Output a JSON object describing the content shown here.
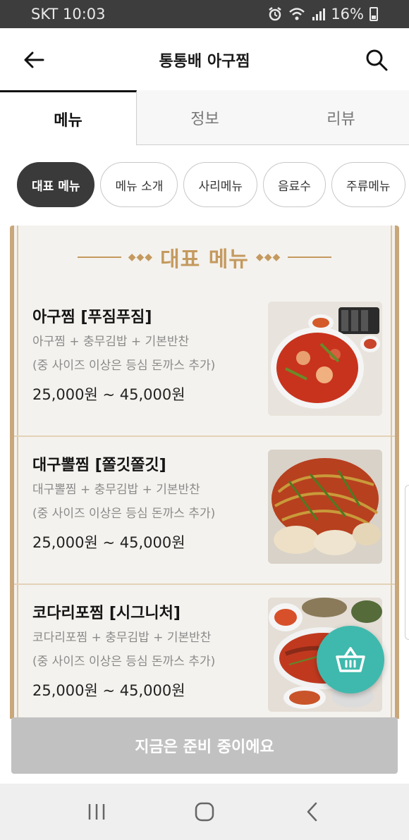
{
  "status_bar": {
    "carrier_time": "SKT 10:03",
    "battery": "16%"
  },
  "header": {
    "title": "통통배 아구찜",
    "back_icon": "arrow-left-icon",
    "search_icon": "search-icon"
  },
  "tabs": [
    {
      "label": "메뉴",
      "active": true
    },
    {
      "label": "정보",
      "active": false
    },
    {
      "label": "리뷰",
      "active": false
    }
  ],
  "chips": [
    {
      "label": "대표 메뉴",
      "active": true
    },
    {
      "label": "메뉴 소개",
      "active": false
    },
    {
      "label": "사리메뉴",
      "active": false
    },
    {
      "label": "음료수",
      "active": false
    },
    {
      "label": "주류메뉴",
      "active": false
    }
  ],
  "menu_section": {
    "title": "대표 메뉴",
    "items": [
      {
        "name": "아구찜 [푸짐푸짐]",
        "desc1": "아구찜 + 충무김밥 + 기본반찬",
        "desc2": "(중 사이즈 이상은 등심 돈까스 추가)",
        "price": "25,000원 ~ 45,000원"
      },
      {
        "name": "대구뽈찜 [쫄깃쫄깃]",
        "desc1": "대구뽈찜 + 충무김밥 + 기본반찬",
        "desc2": "(중 사이즈 이상은 등심 돈까스 추가)",
        "price": "25,000원 ~ 45,000원"
      },
      {
        "name": "코다리포찜 [시그니처]",
        "desc1": "코다리포찜 + 충무김밥 + 기본반찬",
        "desc2": "(중 사이즈 이상은 등심 돈까스 추가)",
        "price": "25,000원 ~ 45,000원"
      }
    ]
  },
  "order_button": {
    "label": "지금은 준비 중이에요"
  },
  "cart": {
    "icon": "basket-icon",
    "color": "#3fb9ad"
  },
  "colors": {
    "accent_gold": "#c49a5f",
    "chip_active": "#3a3a3a",
    "disabled_button": "#c1c1c1"
  }
}
